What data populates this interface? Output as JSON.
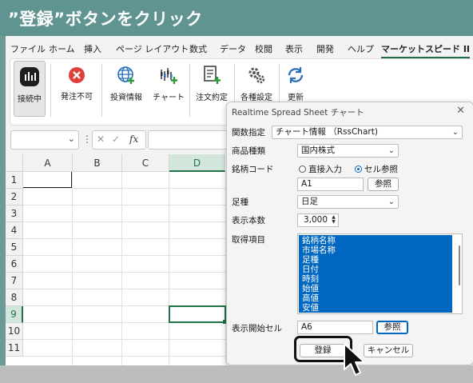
{
  "header": {
    "title": "”登録”ボタンをクリック"
  },
  "menu": {
    "items": [
      "ファイル",
      "ホーム",
      "挿入",
      "ページ レイアウト",
      "数式",
      "データ",
      "校閲",
      "表示",
      "開発",
      "ヘルプ",
      "マーケットスピード II"
    ],
    "active_index": 10
  },
  "ribbon": {
    "buttons": [
      "接続中",
      "発注不可",
      "投資情報",
      "チャート",
      "注文約定",
      "各種設定",
      "更新"
    ],
    "active_index": 0
  },
  "formula_bar": {
    "fx": "fx"
  },
  "sheet": {
    "columns": [
      "A",
      "B",
      "C",
      "D"
    ],
    "rows": [
      "1",
      "2",
      "3",
      "4",
      "5",
      "6",
      "7",
      "8",
      "9",
      "10",
      "11"
    ],
    "selected_column": "D",
    "selected_row": "9"
  },
  "dialog": {
    "title": "Realtime Spread Sheet チャート",
    "close": "✕",
    "func_label": "関数指定",
    "func_value": "チャート情報 （RssChart)",
    "product_label": "商品種類",
    "product_value": "国内株式",
    "code_label": "銘柄コード",
    "radio_direct": "直接入力",
    "radio_cell": "セル参照",
    "code_value": "A1",
    "ref_button": "参照",
    "period_label": "足種",
    "period_value": "日足",
    "count_label": "表示本数",
    "count_value": "3,000",
    "items_label": "取得項目",
    "items": [
      "銘柄名称",
      "市場名称",
      "足種",
      "日付",
      "時刻",
      "始値",
      "高値",
      "安値"
    ],
    "start_label": "表示開始セル",
    "start_value": "A6",
    "ref_button2": "参照",
    "register_button": "登録",
    "cancel_button": "キャンセル"
  },
  "colors": {
    "header_bg": "#5f9491",
    "accent_green": "#217346",
    "selection_blue": "#0067c0",
    "error_red": "#e0403a"
  }
}
